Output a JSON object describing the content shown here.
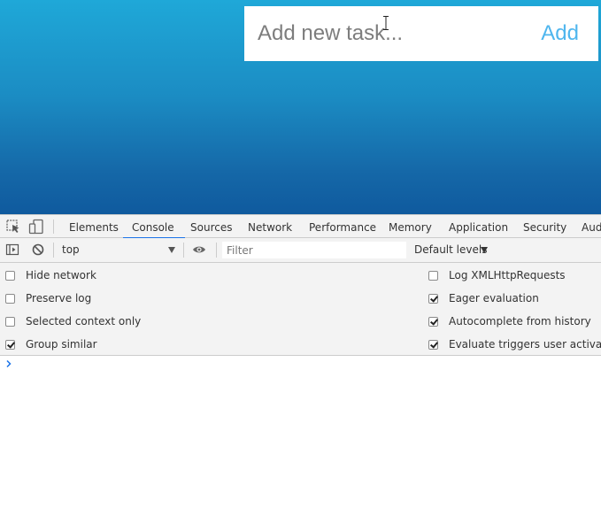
{
  "app": {
    "task_placeholder": "Add new task...",
    "add_label": "Add",
    "accent_color": "#4fb6ee"
  },
  "devtools": {
    "tabs": [
      {
        "label": "Elements",
        "active": false
      },
      {
        "label": "Console",
        "active": true
      },
      {
        "label": "Sources",
        "active": false
      },
      {
        "label": "Network",
        "active": false
      },
      {
        "label": "Performance",
        "active": false
      },
      {
        "label": "Memory",
        "active": false
      },
      {
        "label": "Application",
        "active": false
      },
      {
        "label": "Security",
        "active": false
      },
      {
        "label": "Aud",
        "active": false
      }
    ],
    "icons": {
      "inspect": "inspect-element-icon",
      "device": "device-toolbar-icon",
      "sidebar": "show-sidebar-icon",
      "clear": "clear-console-icon",
      "eye": "live-expression-eye-icon",
      "prompt": "console-prompt-chevron-icon"
    },
    "toolbar": {
      "context": "top",
      "filter_placeholder": "Filter",
      "levels": "Default levels"
    },
    "settings": {
      "left": [
        {
          "label": "Hide network",
          "checked": false
        },
        {
          "label": "Preserve log",
          "checked": false
        },
        {
          "label": "Selected context only",
          "checked": false
        },
        {
          "label": "Group similar",
          "checked": true
        }
      ],
      "right": [
        {
          "label": "Log XMLHttpRequests",
          "checked": false
        },
        {
          "label": "Eager evaluation",
          "checked": true
        },
        {
          "label": "Autocomplete from history",
          "checked": true
        },
        {
          "label": "Evaluate triggers user activation",
          "checked": true
        }
      ]
    }
  }
}
